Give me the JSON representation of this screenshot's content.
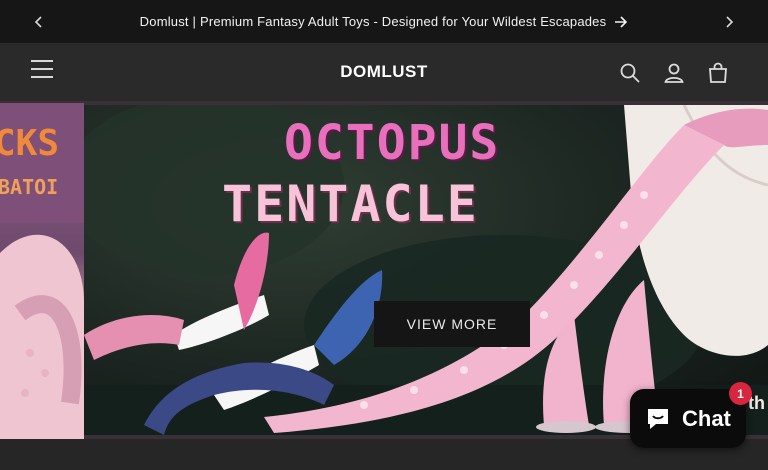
{
  "announcement": {
    "text": "Domlust | Premium Fantasy Adult Toys - Designed for Your Wildest Escapades",
    "prev_icon": "chevron-left-icon",
    "next_icon": "chevron-right-icon",
    "link_icon": "arrow-right-icon"
  },
  "header": {
    "logo_text": "DOMLUST",
    "menu_icon": "hamburger-menu-icon",
    "search_icon": "search-icon",
    "account_icon": "user-icon",
    "cart_icon": "cart-icon"
  },
  "banner": {
    "left_slide_partial_text_1": "CKS",
    "left_slide_partial_text_2": "BATOI",
    "title_line1": "OCTOPUS",
    "title_line2": "TENTACLE",
    "button_label": "VIEW MORE",
    "right_partial_text": "th"
  },
  "chat_widget": {
    "label": "Chat",
    "badge_count": "1",
    "icon": "chat-bubble-icon"
  },
  "colors": {
    "announcement_bg": "#161616",
    "header_bg": "#2a2a2a",
    "title_pink": "#e86fbc",
    "title_light_pink": "#f6c3d8",
    "badge_red": "#d7263d"
  }
}
